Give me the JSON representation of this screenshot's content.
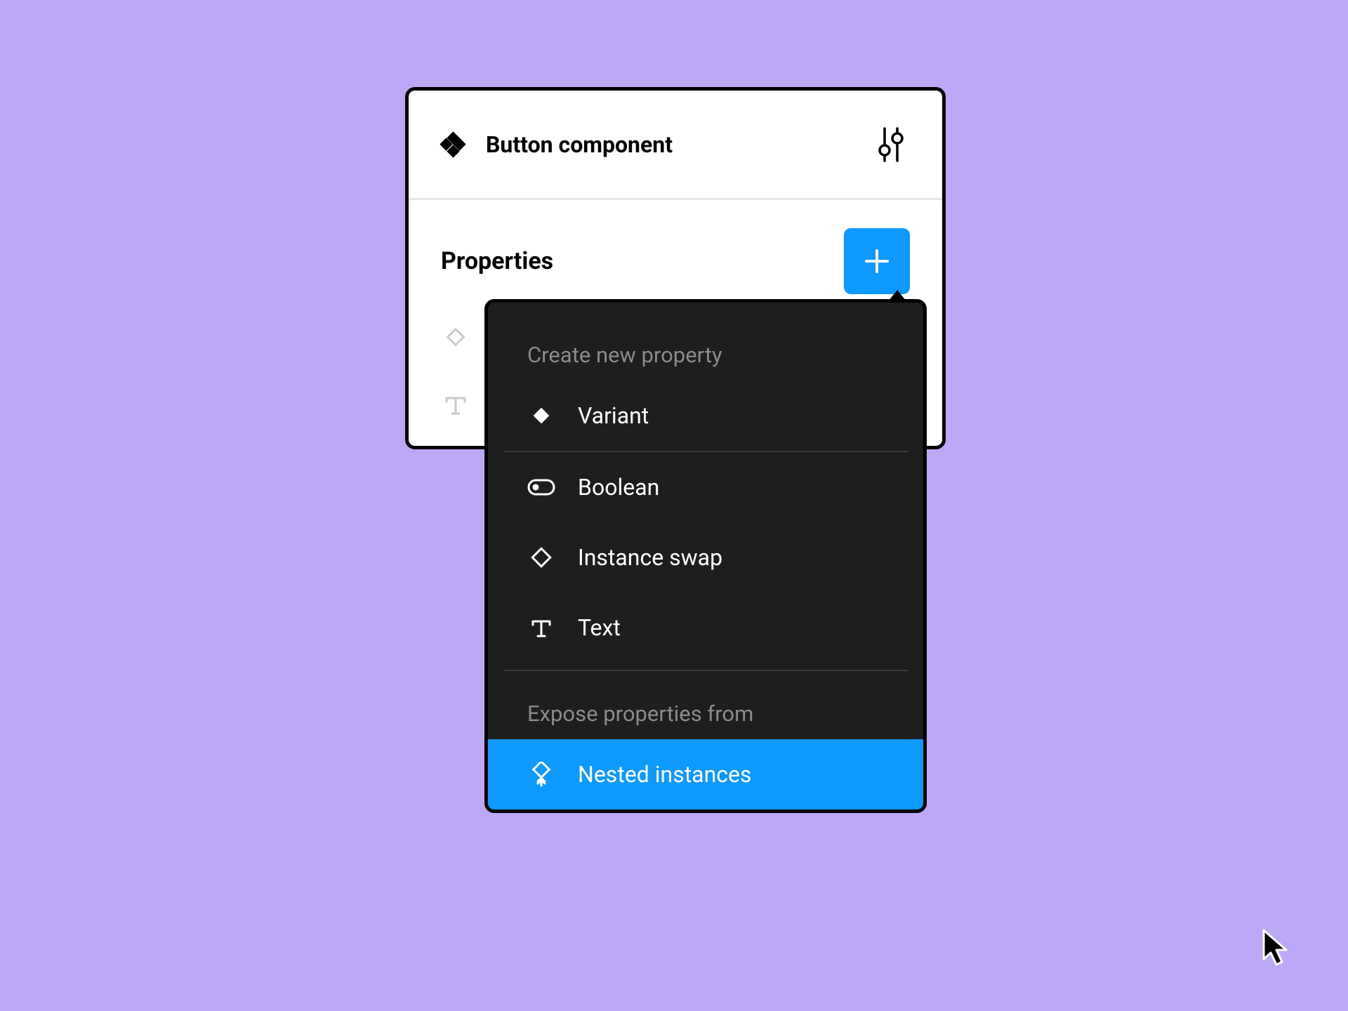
{
  "panel": {
    "title": "Button component",
    "properties_label": "Properties"
  },
  "dropdown": {
    "create_label": "Create new property",
    "expose_label": "Expose properties from",
    "items": {
      "variant": "Variant",
      "boolean": "Boolean",
      "instance_swap": "Instance swap",
      "text": "Text",
      "nested_instances": "Nested instances"
    }
  },
  "colors": {
    "background": "#bda8f7",
    "accent": "#0d99ff",
    "panel_bg": "#ffffff",
    "dropdown_bg": "#1e1e1e"
  }
}
